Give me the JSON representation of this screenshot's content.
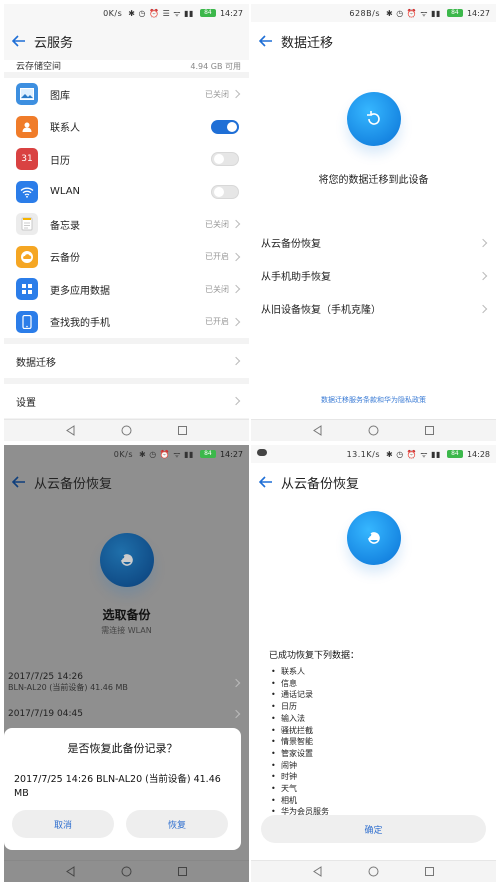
{
  "colors": {
    "accent": "#1f6fd6",
    "link": "#3a7bd5",
    "dim_overlay": "#8f8f8f",
    "battery": "#3cb84b"
  },
  "panel1": {
    "status": {
      "net": "0K/s",
      "time": "14:27",
      "battery": "84"
    },
    "title": "云服务",
    "storage": {
      "label": "云存储空间",
      "value": "4.94 GB 可用"
    },
    "items": [
      {
        "label": "图库",
        "value": "已关闭",
        "icon": "gallery-icon",
        "color": "#3d8fe0"
      },
      {
        "label": "联系人",
        "toggle": "on",
        "icon": "contacts-icon",
        "color": "#f07c2a"
      },
      {
        "label": "日历",
        "toggle": "off",
        "icon": "calendar-icon",
        "color": "#d94242",
        "icon_text": "31"
      },
      {
        "label": "WLAN",
        "toggle": "off",
        "icon": "wifi-icon",
        "color": "#2b7de9"
      },
      {
        "label": "备忘录",
        "value": "已关闭",
        "icon": "notes-icon",
        "color": "#e9e9e9"
      },
      {
        "label": "云备份",
        "value": "已开启",
        "icon": "cloud-backup-icon",
        "color": "#f5a623"
      },
      {
        "label": "更多应用数据",
        "value": "已关闭",
        "icon": "more-apps-icon",
        "color": "#2b7de9"
      },
      {
        "label": "查找我的手机",
        "value": "已开启",
        "icon": "find-phone-icon",
        "color": "#2b7de9"
      }
    ],
    "migrate": "数据迁移",
    "settings": "设置"
  },
  "panel2": {
    "status": {
      "net": "628B/s",
      "time": "14:27",
      "battery": "84"
    },
    "title": "数据迁移",
    "caption": "将您的数据迁移到此设备",
    "options": [
      "从云备份恢复",
      "从手机助手恢复",
      "从旧设备恢复（手机克隆）"
    ],
    "link": "数据迁移服务条款和华为隐私政策"
  },
  "panel3": {
    "status": {
      "net": "0K/s",
      "time": "14:27",
      "battery": "84"
    },
    "title": "从云备份恢复",
    "heading": "选取备份",
    "sub": "需连接 WLAN",
    "backups": [
      {
        "date": "2017/7/25 14:26",
        "meta": "BLN-AL20 (当前设备) 41.46 MB"
      },
      {
        "date": "2017/7/19 04:45",
        "meta": ""
      }
    ],
    "dialog": {
      "title": "是否恢复此备份记录？",
      "body": "2017/7/25 14:26 BLN-AL20 (当前设备) 41.46 MB",
      "cancel": "取消",
      "restore": "恢复"
    }
  },
  "panel4": {
    "status": {
      "net": "13.1K/s",
      "time": "14:28",
      "battery": "84"
    },
    "title": "从云备份恢复",
    "head": "已成功恢复下列数据：",
    "items": [
      "联系人",
      "信息",
      "通话记录",
      "日历",
      "输入法",
      "骚扰拦截",
      "情景智能",
      "管家设置",
      "闹钟",
      "时钟",
      "天气",
      "相机",
      "华为会员服务"
    ],
    "confirm": "确定"
  }
}
